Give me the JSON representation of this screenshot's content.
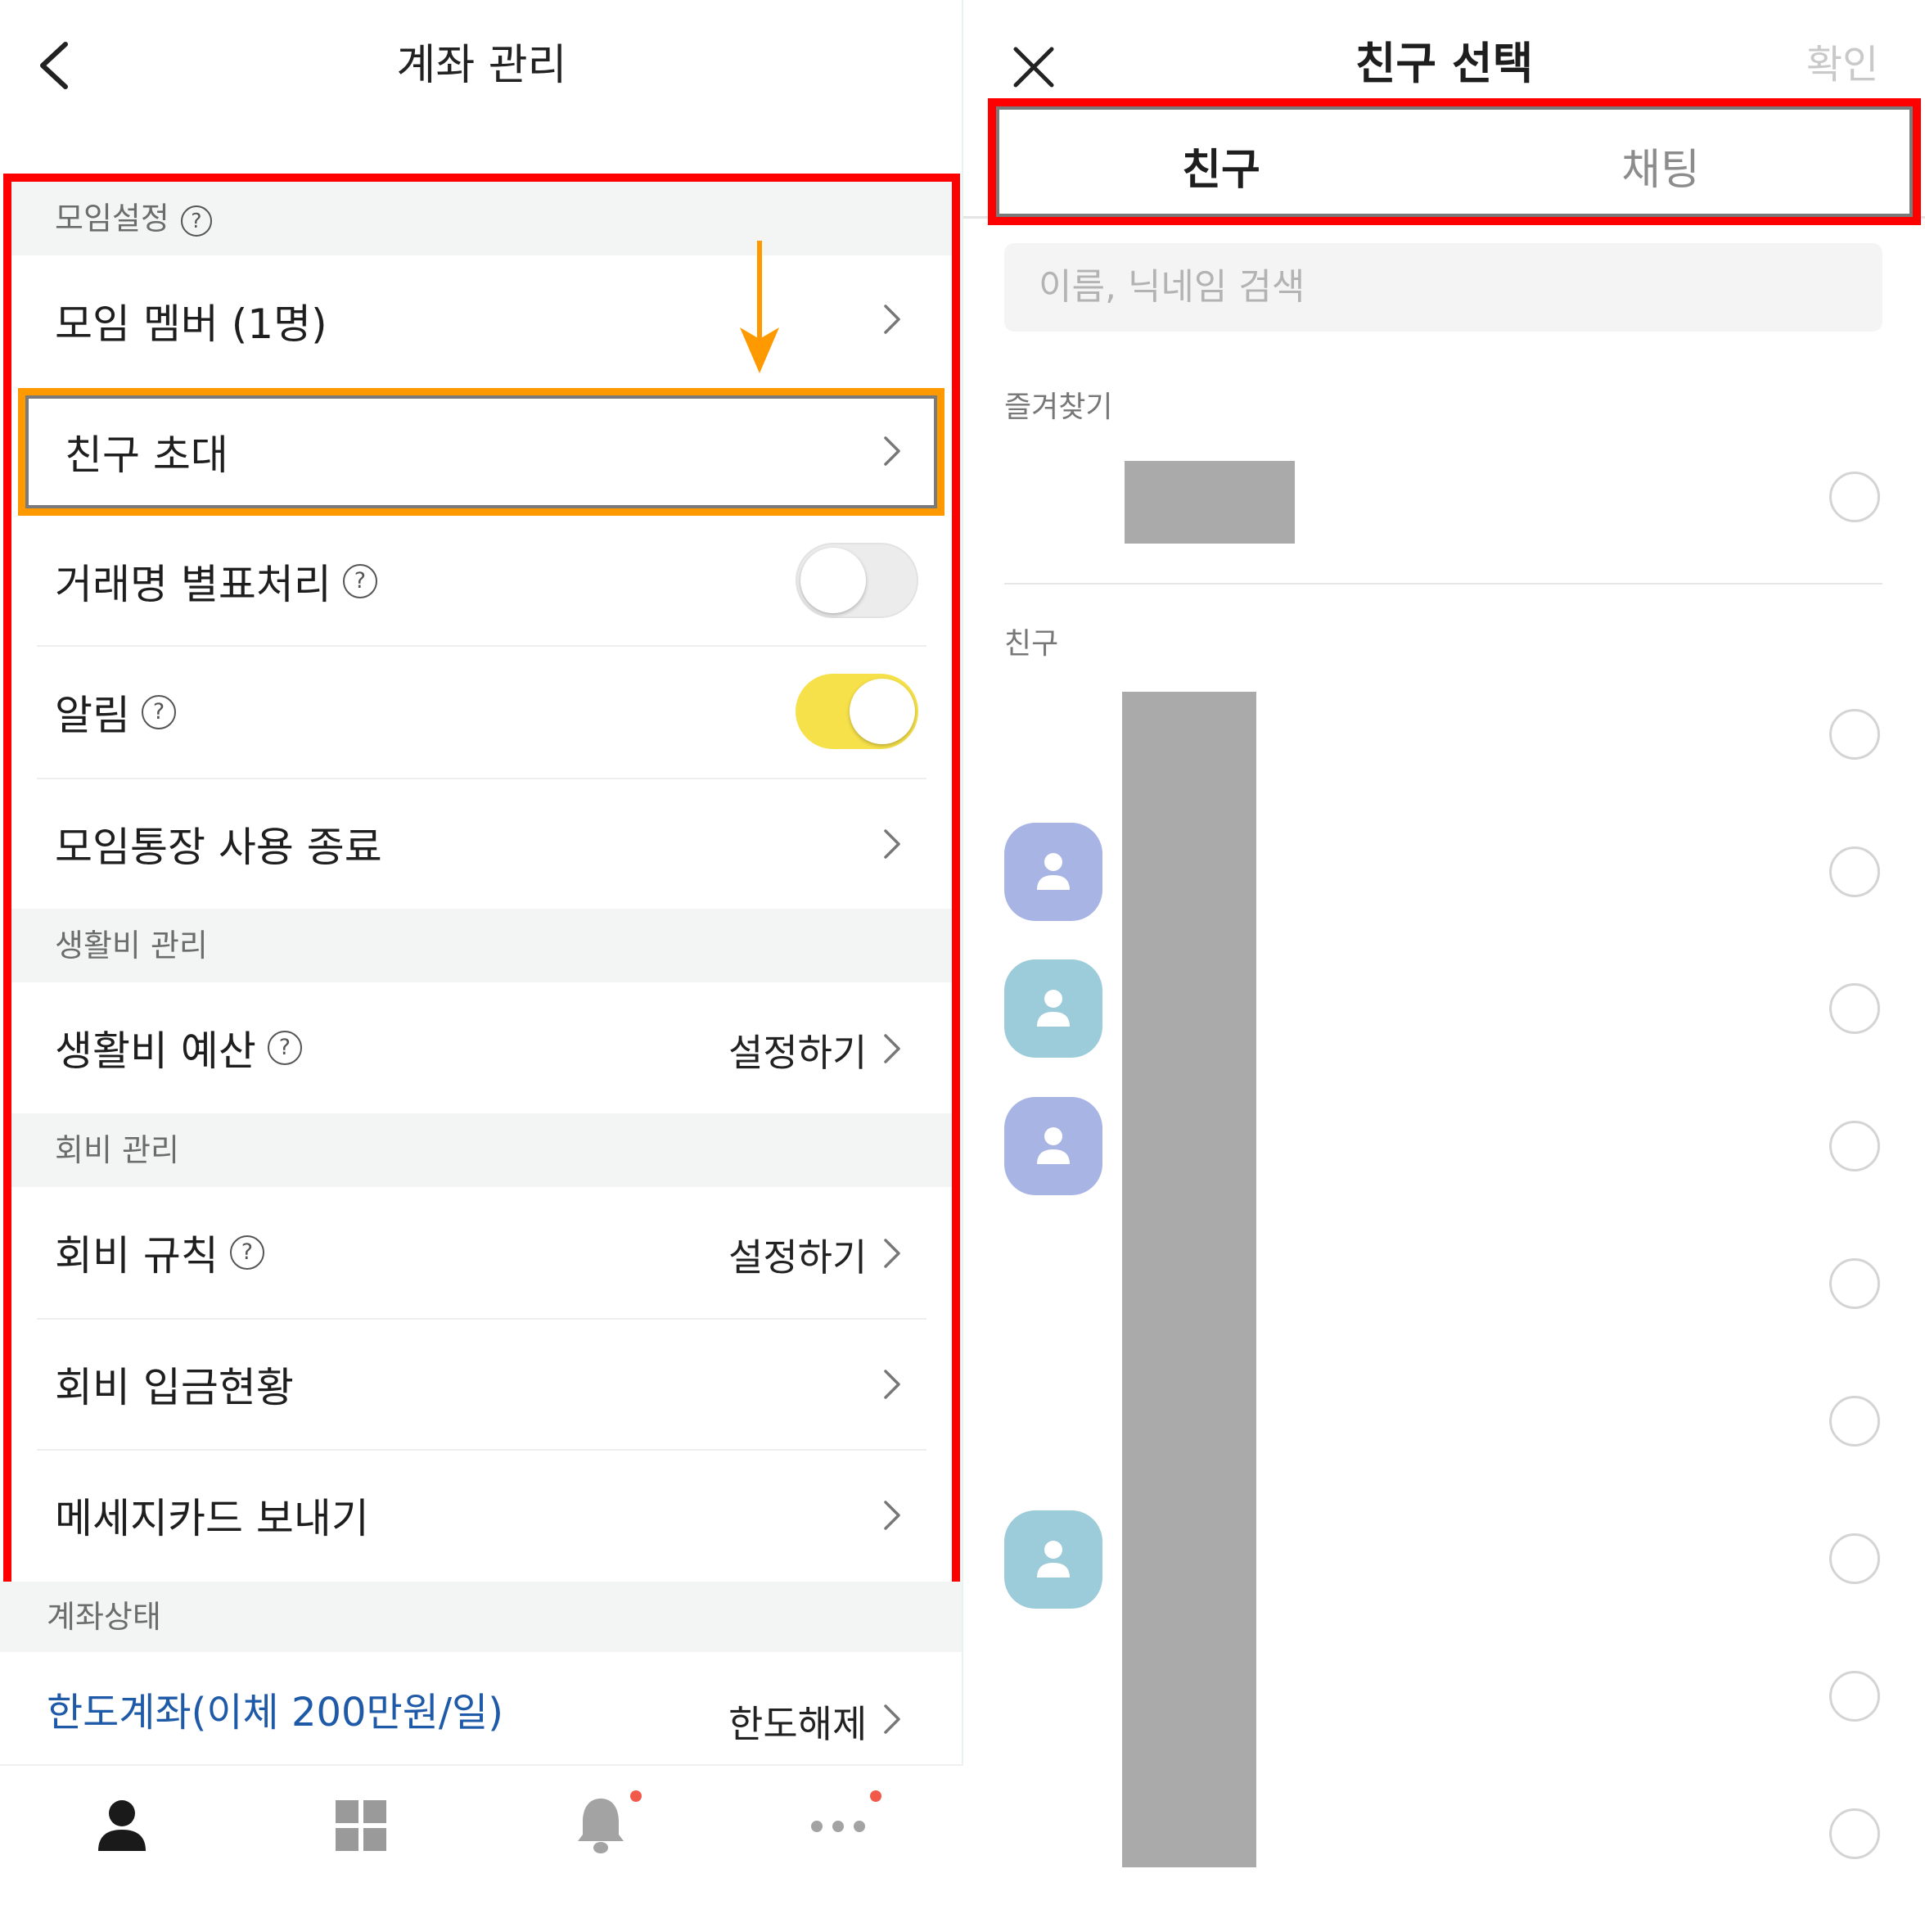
{
  "left": {
    "title": "계좌 관리",
    "sections": {
      "group_settings": "모임설정",
      "living": "생활비 관리",
      "dues": "회비 관리",
      "account_status": "계좌상태"
    },
    "rows": {
      "members": "모임 멤버 (1명)",
      "invite": "친구 초대",
      "star_names": "거래명 별표처리",
      "alarm": "알림",
      "end_usage": "모임통장 사용 종료",
      "budget": "생활비 예산",
      "budget_action": "설정하기",
      "dues_rule": "회비 규칙",
      "dues_rule_action": "설정하기",
      "dues_status": "회비 입금현황",
      "message_card": "메세지카드 보내기",
      "limit_account": "한도계좌(이체 200만원/일)",
      "limit_action": "한도해제"
    },
    "help_glyph": "?",
    "toggles": {
      "star_names": false,
      "alarm": true
    },
    "nav": [
      "person-icon",
      "grid-icon",
      "bell-icon",
      "more-icon"
    ],
    "colors": {
      "highlight_red": "#ff0000",
      "highlight_orange": "#ff9900",
      "toggle_on": "#f6e14a",
      "link_blue": "#1f5aa8"
    }
  },
  "right": {
    "title": "친구 선택",
    "confirm": "확인",
    "tabs": [
      "친구",
      "채팅"
    ],
    "search_placeholder": "이름, 닉네임 검색",
    "favorites_label": "즐겨찾기",
    "friends_label": "친구",
    "avatar_colors": [
      "#a8b4e4",
      "#9ccbd9",
      "#a8b4e4",
      "#9ccbd9"
    ]
  }
}
